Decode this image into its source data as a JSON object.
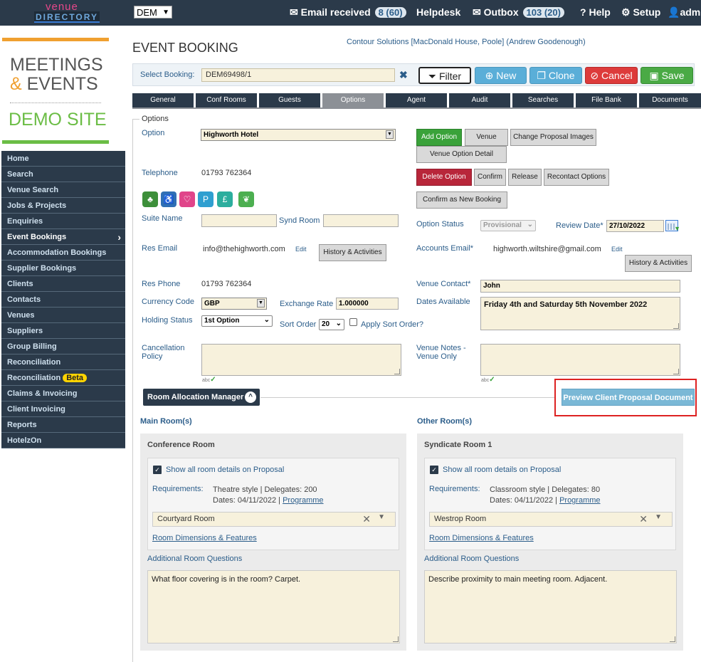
{
  "topbar": {
    "logo_top": "venue",
    "logo_bottom": "DIRECTORY",
    "db_select": "DEM",
    "email_label": "Email received",
    "email_badge": "8 (60)",
    "helpdesk": "Helpdesk",
    "outbox_label": "Outbox",
    "outbox_badge": "103 (20)",
    "help": "Help",
    "setup": "Setup",
    "admin": "admin"
  },
  "brand": {
    "line1": "MEETINGS",
    "amp": "&",
    "line2": " EVENTS",
    "demo": "DEMO SITE"
  },
  "sidebar": {
    "items": [
      {
        "label": "Home"
      },
      {
        "label": "Search"
      },
      {
        "label": "Venue Search"
      },
      {
        "label": "Jobs & Projects"
      },
      {
        "label": "Enquiries"
      },
      {
        "label": "Event Bookings"
      },
      {
        "label": "Accommodation Bookings"
      },
      {
        "label": "Supplier Bookings"
      },
      {
        "label": "Clients"
      },
      {
        "label": "Contacts"
      },
      {
        "label": "Venues"
      },
      {
        "label": "Suppliers"
      },
      {
        "label": "Group Billing"
      },
      {
        "label": "Reconciliation"
      },
      {
        "label": "Reconciliation"
      },
      {
        "label": "Claims & Invoicing"
      },
      {
        "label": "Client Invoicing"
      },
      {
        "label": "Reports"
      },
      {
        "label": "HotelzOn"
      }
    ],
    "beta_label": "Beta",
    "active_arrow": "›"
  },
  "header": {
    "title": "EVENT BOOKING",
    "client": "Contour Solutions [MacDonald House, Poole] (Andrew Goodenough)",
    "select_label": "Select Booking:",
    "booking_ref": "DEM69498/1",
    "buttons": {
      "filter": "Filter",
      "new": "New",
      "clone": "Clone",
      "cancel": "Cancel",
      "save": "Save"
    }
  },
  "tabs": [
    "General",
    "Conf Rooms",
    "Guests",
    "Options",
    "Agent",
    "Audit",
    "Searches",
    "File Bank",
    "Documents"
  ],
  "options": {
    "legend": "Options",
    "option_label": "Option",
    "option_value": "Highworth Hotel",
    "telephone_label": "Telephone",
    "telephone": "01793 762364",
    "suite_label": "Suite Name",
    "synd_label": "Synd Room",
    "res_email_label": "Res Email",
    "res_email": "info@thehighworth.com",
    "edit": "Edit",
    "history_btn": "History & Activities",
    "res_phone_label": "Res Phone",
    "res_phone": "01793 762364",
    "currency_label": "Currency Code",
    "currency": "GBP",
    "exchange_label": "Exchange Rate",
    "exchange": "1.000000",
    "holding_label": "Holding Status",
    "holding": "1st Option",
    "sort_label": "Sort Order",
    "sort": "20",
    "apply_sort": "Apply Sort Order?",
    "cancel_label_1": "Cancellation",
    "cancel_label_2": "Policy",
    "buttons": {
      "add_option": "Add Option",
      "venue": "Venue",
      "change_images": "Change Proposal Images",
      "venue_option_detail": "Venue Option Detail",
      "delete_option": "Delete Option",
      "confirm": "Confirm",
      "release": "Release",
      "recontact": "Recontact Options",
      "confirm_new": "Confirm as New Booking"
    },
    "option_status_label": "Option Status",
    "option_status": "Provisional",
    "review_label": "Review Date*",
    "review_date": "27/10/2022",
    "accounts_label": "Accounts Email*",
    "accounts_email": "highworth.wiltshire@gmail.com",
    "venue_contact_label": "Venue Contact*",
    "venue_contact": "John",
    "dates_label": "Dates Available",
    "dates": "Friday 4th and Saturday 5th November 2022",
    "venue_notes_label_1": "Venue Notes -",
    "venue_notes_label_2": "Venue Only",
    "spell": "abc"
  },
  "ram": {
    "label": "Room Allocation Manager",
    "toggle": "^",
    "preview": "Preview Client Proposal Document"
  },
  "rooms": {
    "main_title": "Main Room(s)",
    "other_title": "Other Room(s)",
    "show_label": "Show all room details on Proposal",
    "req_label": "Requirements:",
    "dims": "Room Dimensions & Features",
    "add_q": "Additional Room Questions",
    "programme": "Programme",
    "main": {
      "name": "Conference Room",
      "req1": "Theatre style | Delegates: 200",
      "req2": "Dates: 04/11/2022 | ",
      "room": "Courtyard Room",
      "question": "What floor covering is in the room? Carpet."
    },
    "other": {
      "name": "Syndicate Room 1",
      "req1": "Classroom style | Delegates: 80",
      "req2": "Dates: 04/11/2022 | ",
      "room": "Westrop Room",
      "question": "Describe proximity to main meeting room. Adjacent."
    }
  },
  "colors": {
    "nav": "#2b3a4a",
    "accent_blue": "#2b5d8a",
    "field_bg": "#f7f1dc",
    "highlight_red": "#dd2222"
  }
}
